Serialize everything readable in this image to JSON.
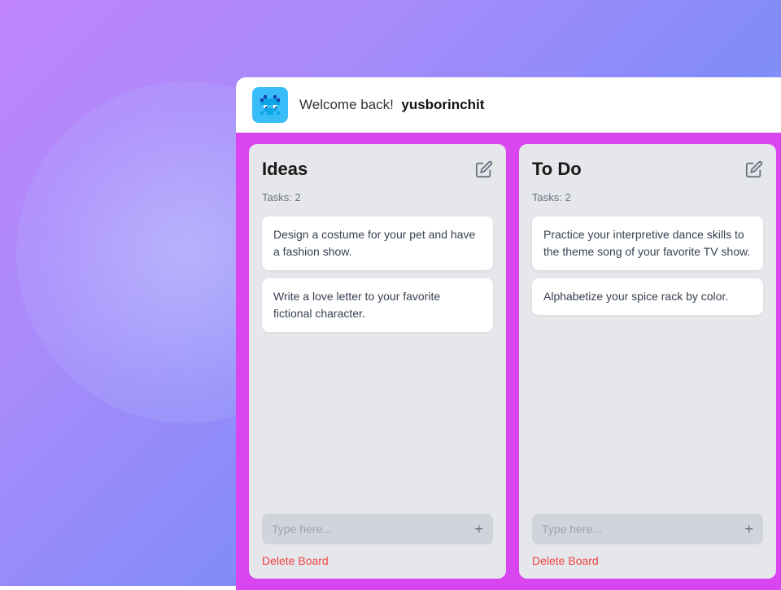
{
  "background": {
    "gradient_start": "#c084fc",
    "gradient_end": "#93c5fd"
  },
  "app": {
    "header": {
      "logo_alt": "App Logo",
      "welcome_prefix": "Welcome back!",
      "username": "yusborinchit"
    },
    "boards": [
      {
        "id": "ideas",
        "title": "Ideas",
        "task_count_label": "Tasks: 2",
        "edit_label": "Edit board",
        "tasks": [
          {
            "text": "Design a costume for your pet and have a fashion show."
          },
          {
            "text": "Write a love letter to your favorite fictional character."
          }
        ],
        "input_placeholder": "Type here...",
        "add_button_label": "+",
        "delete_label": "Delete Board"
      },
      {
        "id": "todo",
        "title": "To Do",
        "task_count_label": "Tasks: 2",
        "edit_label": "Edit board",
        "tasks": [
          {
            "text": "Practice your interpretive dance skills to the theme song of your favorite TV show."
          },
          {
            "text": "Alphabetize your spice rack by color."
          }
        ],
        "input_placeholder": "Type here...",
        "add_button_label": "+",
        "delete_label": "Delete Board"
      }
    ]
  }
}
